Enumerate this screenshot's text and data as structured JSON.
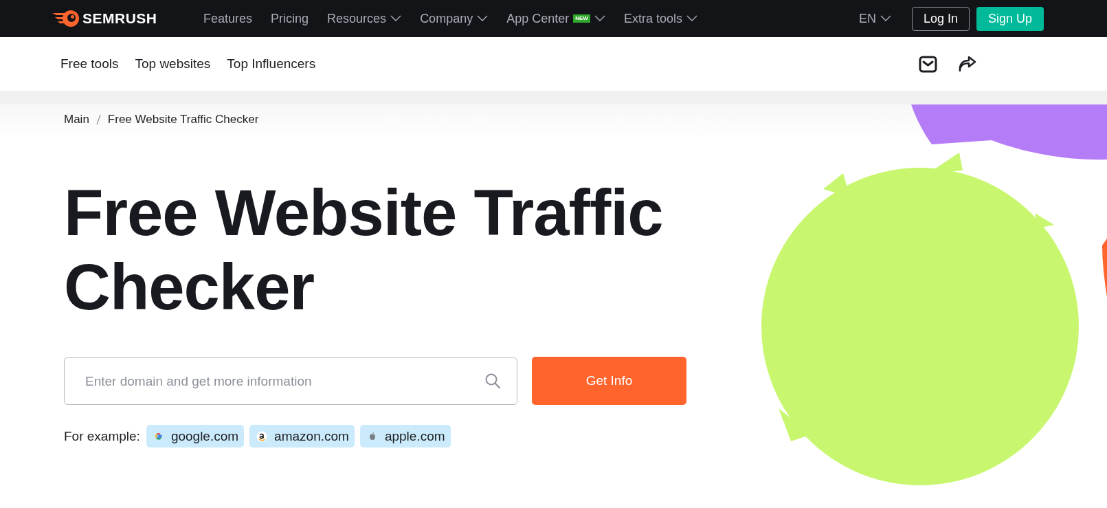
{
  "top_nav": {
    "brand": "SEMRUSH",
    "items": [
      {
        "label": "Features",
        "dropdown": false
      },
      {
        "label": "Pricing",
        "dropdown": false
      },
      {
        "label": "Resources",
        "dropdown": true
      },
      {
        "label": "Company",
        "dropdown": true
      },
      {
        "label": "App Center",
        "badge": "NEW",
        "dropdown": true
      },
      {
        "label": "Extra tools",
        "dropdown": true
      }
    ],
    "language": "EN",
    "login": "Log In",
    "signup": "Sign Up"
  },
  "sub_nav": {
    "links": [
      "Free tools",
      "Top websites",
      "Top Influencers"
    ]
  },
  "breadcrumb": [
    "Main",
    "Free Website Traffic Checker"
  ],
  "heading": "Free Website Traffic Checker",
  "search": {
    "placeholder": "Enter domain and get more information",
    "button": "Get Info"
  },
  "examples": {
    "label": "For example:",
    "items": [
      {
        "kind": "google",
        "text": "google.com"
      },
      {
        "kind": "amazon",
        "text": "amazon.com"
      },
      {
        "kind": "apple",
        "text": "apple.com"
      }
    ]
  }
}
